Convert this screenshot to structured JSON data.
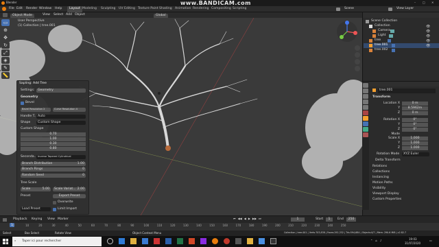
{
  "watermark": "www.BANDICAM.com",
  "window": {
    "title": "Blender"
  },
  "menus": [
    "File",
    "Edit",
    "Render",
    "Window",
    "Help"
  ],
  "workspaces": [
    "Layout",
    "Modeling",
    "Sculpting",
    "UV Editing",
    "Texture Paint",
    "Shading",
    "Animation",
    "Rendering",
    "Compositing",
    "Scripting"
  ],
  "active_workspace": "Layout",
  "scene": {
    "label": "Scene",
    "view_layer": "View Layer"
  },
  "viewport_header": {
    "mode": "Object Mode",
    "items": [
      "View",
      "Select",
      "Add",
      "Object"
    ],
    "transform": "Global"
  },
  "viewport": {
    "perspective": "User Perspective",
    "collection": "(1) Collection | tree.001"
  },
  "operator_panel": {
    "title": "Sapling: Add Tree",
    "settings_label": "Settings:",
    "settings_value": "Geometry",
    "section": "Geometry",
    "bevel_label": "Bevel",
    "bevel_checked": true,
    "bevel_resolution": "Bevel Resolution  2",
    "curve_resolution": "Curve Resolution  4",
    "handle_label": "Handle T...",
    "handle_value": "Auto",
    "shape_label": "Shape",
    "shape_value": "Custom Shape",
    "custom_shape_label": "Custom Shape",
    "custom_shape_values": [
      "0.70",
      "1.00",
      "0.30",
      "0.80"
    ],
    "secondary_label": "Seconda...",
    "secondary_value": "Inverse Tapered Cylindrical",
    "branch_distribution": {
      "label": "Branch Distribution",
      "value": "1.00"
    },
    "branch_rings": {
      "label": "Branch Rings",
      "value": "0"
    },
    "random_seed": {
      "label": "Random Seed",
      "value": "0"
    },
    "tree_scale_label": "Tree Scale",
    "scale": {
      "label": "Scale",
      "value": "5.00"
    },
    "scale_variation": {
      "label": "Scale Variat...",
      "value": "2.00"
    },
    "preset_label": "Preset",
    "export_preset": "Export Preset",
    "overwrite_label": "Overwrite",
    "load_preset": "Load Preset",
    "limit_import_label": "Limit Import",
    "limit_import_checked": true
  },
  "outliner": {
    "title": "Scene Collection",
    "items": [
      {
        "label": "Scene Collection",
        "level": 0
      },
      {
        "label": "Collection",
        "level": 1
      },
      {
        "label": "Camera",
        "level": 2
      },
      {
        "label": "Light",
        "level": 2
      },
      {
        "label": "tree",
        "level": 1
      },
      {
        "label": "tree.001",
        "level": 1
      },
      {
        "label": "tree.002",
        "level": 1
      }
    ]
  },
  "properties": {
    "object_name": "tree.001",
    "transform_label": "Transform",
    "location_x": {
      "label": "Location X",
      "value": "0 m"
    },
    "location_y": {
      "label": "Y",
      "value": "8.5962m"
    },
    "location_z": {
      "label": "Z",
      "value": "0 m"
    },
    "rotation_x": {
      "label": "Rotation X",
      "value": "0°"
    },
    "rotation_y": {
      "label": "Y",
      "value": "0°"
    },
    "rotation_z": {
      "label": "Z",
      "value": "0°"
    },
    "mode_label": "Mode",
    "scale_x": {
      "label": "Scale X",
      "value": "1.000"
    },
    "scale_y": {
      "label": "Y",
      "value": "1.000"
    },
    "scale_z": {
      "label": "Z",
      "value": "1.000"
    },
    "rotation_mode_label": "Rotation Mode",
    "rotation_mode_value": "XYZ Euler",
    "sections": [
      "Delta Transform",
      "Relations",
      "Collections",
      "Instancing",
      "Motion Paths",
      "Visibility",
      "Viewport Display",
      "Custom Properties"
    ]
  },
  "timeline": {
    "menus": [
      "Playback",
      "Keying",
      "View",
      "Marker"
    ],
    "current_frame": "1",
    "start_label": "Start",
    "start": "1",
    "end_label": "End",
    "end": "250",
    "ticks": [
      "0",
      "10",
      "20",
      "30",
      "40",
      "50",
      "60",
      "70",
      "80",
      "90",
      "100",
      "110",
      "120",
      "130",
      "140",
      "150",
      "160",
      "170",
      "180",
      "190",
      "200",
      "210",
      "220",
      "230",
      "240",
      "250"
    ]
  },
  "statusbar": {
    "select": "Select",
    "box_select": "Box Select",
    "rotate_view": "Rotate View",
    "context_menu": "Object Context Menu",
    "stats": "Collection | tree.001 | Verts:703,838 | Faces:292,332 | Tris:594,684 | Objects:0/7 | Mem: 290.6 MiB | v2.82.7"
  },
  "taskbar": {
    "search_placeholder": "Taper ici pour rechercher",
    "time": "19:03",
    "date": "31/07/2020"
  },
  "colors": {
    "accent": "#4772b3",
    "selected_orange": "#f5a030",
    "panel_bg": "#303030",
    "viewport_bg": "#3a3a3a"
  }
}
